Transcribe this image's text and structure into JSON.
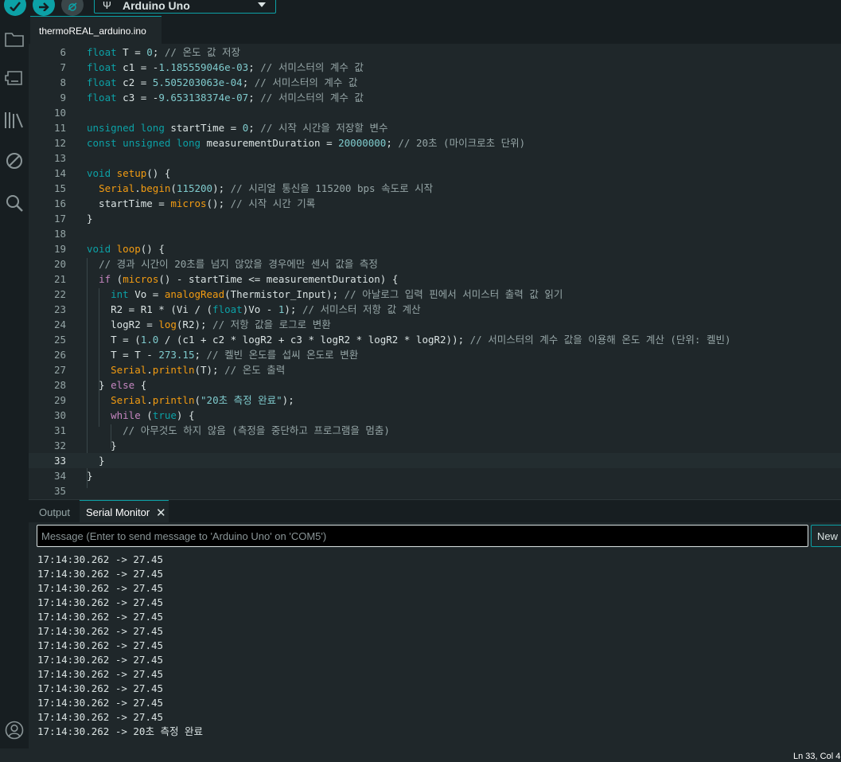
{
  "toolbar": {
    "board": "Arduino Uno"
  },
  "tab": {
    "filename": "thermoREAL_arduino.ino"
  },
  "editor": {
    "current_line": 33,
    "lines": [
      {
        "num": 6,
        "tokens": [
          {
            "t": "float",
            "c": "ty"
          },
          {
            "t": " T = "
          },
          {
            "t": "0",
            "c": "num"
          },
          {
            "t": "; "
          },
          {
            "t": "// 온도 값 저장",
            "c": "cm"
          }
        ]
      },
      {
        "num": 7,
        "tokens": [
          {
            "t": "float",
            "c": "ty"
          },
          {
            "t": " c1 = -"
          },
          {
            "t": "1.185559046e-03",
            "c": "num"
          },
          {
            "t": "; "
          },
          {
            "t": "// 서미스터의 계수 값",
            "c": "cm"
          }
        ]
      },
      {
        "num": 8,
        "tokens": [
          {
            "t": "float",
            "c": "ty"
          },
          {
            "t": " c2 = "
          },
          {
            "t": "5.505203063e-04",
            "c": "num"
          },
          {
            "t": "; "
          },
          {
            "t": "// 서미스터의 계수 값",
            "c": "cm"
          }
        ]
      },
      {
        "num": 9,
        "tokens": [
          {
            "t": "float",
            "c": "ty"
          },
          {
            "t": " c3 = -"
          },
          {
            "t": "9.653138374e-07",
            "c": "num"
          },
          {
            "t": "; "
          },
          {
            "t": "// 서미스터의 계수 값",
            "c": "cm"
          }
        ]
      },
      {
        "num": 10,
        "tokens": []
      },
      {
        "num": 11,
        "tokens": [
          {
            "t": "unsigned",
            "c": "ty"
          },
          {
            "t": " "
          },
          {
            "t": "long",
            "c": "ty"
          },
          {
            "t": " startTime = "
          },
          {
            "t": "0",
            "c": "num"
          },
          {
            "t": "; "
          },
          {
            "t": "// 시작 시간을 저장할 변수",
            "c": "cm"
          }
        ]
      },
      {
        "num": 12,
        "tokens": [
          {
            "t": "const",
            "c": "ty"
          },
          {
            "t": " "
          },
          {
            "t": "unsigned",
            "c": "ty"
          },
          {
            "t": " "
          },
          {
            "t": "long",
            "c": "ty"
          },
          {
            "t": " measurementDuration = "
          },
          {
            "t": "20000000",
            "c": "num"
          },
          {
            "t": "; "
          },
          {
            "t": "// 20초 (마이크로초 단위)",
            "c": "cm"
          }
        ]
      },
      {
        "num": 13,
        "tokens": []
      },
      {
        "num": 14,
        "tokens": [
          {
            "t": "void",
            "c": "ty"
          },
          {
            "t": " "
          },
          {
            "t": "setup",
            "c": "fn"
          },
          {
            "t": "() {"
          }
        ]
      },
      {
        "num": 15,
        "tokens": [
          {
            "t": "  "
          },
          {
            "t": "Serial",
            "c": "fn"
          },
          {
            "t": "."
          },
          {
            "t": "begin",
            "c": "fn"
          },
          {
            "t": "("
          },
          {
            "t": "115200",
            "c": "num"
          },
          {
            "t": "); "
          },
          {
            "t": "// 시리얼 통신을 115200 bps 속도로 시작",
            "c": "cm"
          }
        ]
      },
      {
        "num": 16,
        "tokens": [
          {
            "t": "  startTime = "
          },
          {
            "t": "micros",
            "c": "fn"
          },
          {
            "t": "(); "
          },
          {
            "t": "// 시작 시간 기록",
            "c": "cm"
          }
        ]
      },
      {
        "num": 17,
        "tokens": [
          {
            "t": "}"
          }
        ]
      },
      {
        "num": 18,
        "tokens": []
      },
      {
        "num": 19,
        "tokens": [
          {
            "t": "void",
            "c": "ty"
          },
          {
            "t": " "
          },
          {
            "t": "loop",
            "c": "fn"
          },
          {
            "t": "() {"
          }
        ]
      },
      {
        "num": 20,
        "tokens": [
          {
            "t": "  "
          },
          {
            "t": "// 경과 시간이 20초를 넘지 않았을 경우에만 센서 값을 측정",
            "c": "cm"
          }
        ]
      },
      {
        "num": 21,
        "tokens": [
          {
            "t": "  "
          },
          {
            "t": "if",
            "c": "kw"
          },
          {
            "t": " ("
          },
          {
            "t": "micros",
            "c": "fn"
          },
          {
            "t": "() - startTime <= measurementDuration) {"
          }
        ]
      },
      {
        "num": 22,
        "tokens": [
          {
            "t": "    "
          },
          {
            "t": "int",
            "c": "ty"
          },
          {
            "t": " Vo = "
          },
          {
            "t": "analogRead",
            "c": "fn"
          },
          {
            "t": "(Thermistor_Input); "
          },
          {
            "t": "// 아날로그 입력 핀에서 서미스터 출력 값 읽기",
            "c": "cm"
          }
        ]
      },
      {
        "num": 23,
        "tokens": [
          {
            "t": "    R2 = R1 * (Vi / ("
          },
          {
            "t": "float",
            "c": "ty"
          },
          {
            "t": ")Vo - "
          },
          {
            "t": "1",
            "c": "num"
          },
          {
            "t": "); "
          },
          {
            "t": "// 서미스터 저항 값 계산",
            "c": "cm"
          }
        ]
      },
      {
        "num": 24,
        "tokens": [
          {
            "t": "    logR2 = "
          },
          {
            "t": "log",
            "c": "fn"
          },
          {
            "t": "(R2); "
          },
          {
            "t": "// 저항 값을 로그로 변환",
            "c": "cm"
          }
        ]
      },
      {
        "num": 25,
        "tokens": [
          {
            "t": "    T = ("
          },
          {
            "t": "1.0",
            "c": "num"
          },
          {
            "t": " / (c1 + c2 * logR2 + c3 * logR2 * logR2 * logR2)); "
          },
          {
            "t": "// 서미스터의 계수 값을 이용해 온도 계산 (단위: 켈빈)",
            "c": "cm"
          }
        ]
      },
      {
        "num": 26,
        "tokens": [
          {
            "t": "    T = T - "
          },
          {
            "t": "273.15",
            "c": "num"
          },
          {
            "t": "; "
          },
          {
            "t": "// 켈빈 온도를 섭씨 온도로 변환",
            "c": "cm"
          }
        ]
      },
      {
        "num": 27,
        "tokens": [
          {
            "t": "    "
          },
          {
            "t": "Serial",
            "c": "fn"
          },
          {
            "t": "."
          },
          {
            "t": "println",
            "c": "fn"
          },
          {
            "t": "(T); "
          },
          {
            "t": "// 온도 출력",
            "c": "cm"
          }
        ]
      },
      {
        "num": 28,
        "tokens": [
          {
            "t": "  } "
          },
          {
            "t": "else",
            "c": "kw"
          },
          {
            "t": " {"
          }
        ]
      },
      {
        "num": 29,
        "tokens": [
          {
            "t": "    "
          },
          {
            "t": "Serial",
            "c": "fn"
          },
          {
            "t": "."
          },
          {
            "t": "println",
            "c": "fn"
          },
          {
            "t": "("
          },
          {
            "t": "\"20초 측정 완료\"",
            "c": "str"
          },
          {
            "t": ");"
          }
        ]
      },
      {
        "num": 30,
        "tokens": [
          {
            "t": "    "
          },
          {
            "t": "while",
            "c": "kw"
          },
          {
            "t": " ("
          },
          {
            "t": "true",
            "c": "ty"
          },
          {
            "t": ") {"
          }
        ]
      },
      {
        "num": 31,
        "tokens": [
          {
            "t": "      "
          },
          {
            "t": "// 아무것도 하지 않음 (측정을 중단하고 프로그램을 멈춤)",
            "c": "cm"
          }
        ]
      },
      {
        "num": 32,
        "tokens": [
          {
            "t": "    }"
          }
        ]
      },
      {
        "num": 33,
        "tokens": [
          {
            "t": "  }"
          }
        ]
      },
      {
        "num": 34,
        "tokens": [
          {
            "t": "}"
          }
        ]
      },
      {
        "num": 35,
        "tokens": []
      }
    ]
  },
  "panel": {
    "tab_output": "Output",
    "tab_serial": "Serial Monitor",
    "close_glyph": "✕",
    "message_placeholder": "Message (Enter to send message to 'Arduino Uno' on 'COM5')",
    "line_ending": "New Line",
    "serial_lines": [
      "17:14:30.262 -> 27.45",
      "17:14:30.262 -> 27.45",
      "17:14:30.262 -> 27.45",
      "17:14:30.262 -> 27.45",
      "17:14:30.262 -> 27.45",
      "17:14:30.262 -> 27.45",
      "17:14:30.262 -> 27.45",
      "17:14:30.262 -> 27.45",
      "17:14:30.262 -> 27.45",
      "17:14:30.262 -> 27.45",
      "17:14:30.262 -> 27.45",
      "17:14:30.262 -> 27.45",
      "17:14:30.262 -> 20초 측정 완료"
    ]
  },
  "status": {
    "cursor": "Ln 33, Col 4"
  },
  "colors": {
    "accent": "#0ca1a6",
    "background": "#1f272a",
    "sidebar": "#171e21"
  },
  "icons": {
    "verify": "check-icon",
    "upload": "arrow-right-icon",
    "debug": "debug-icon",
    "sketchbook": "folder-icon",
    "boards": "board-manager-icon",
    "libraries": "library-icon",
    "debug_view": "no-entry-icon",
    "search": "search-icon",
    "account": "account-icon"
  }
}
